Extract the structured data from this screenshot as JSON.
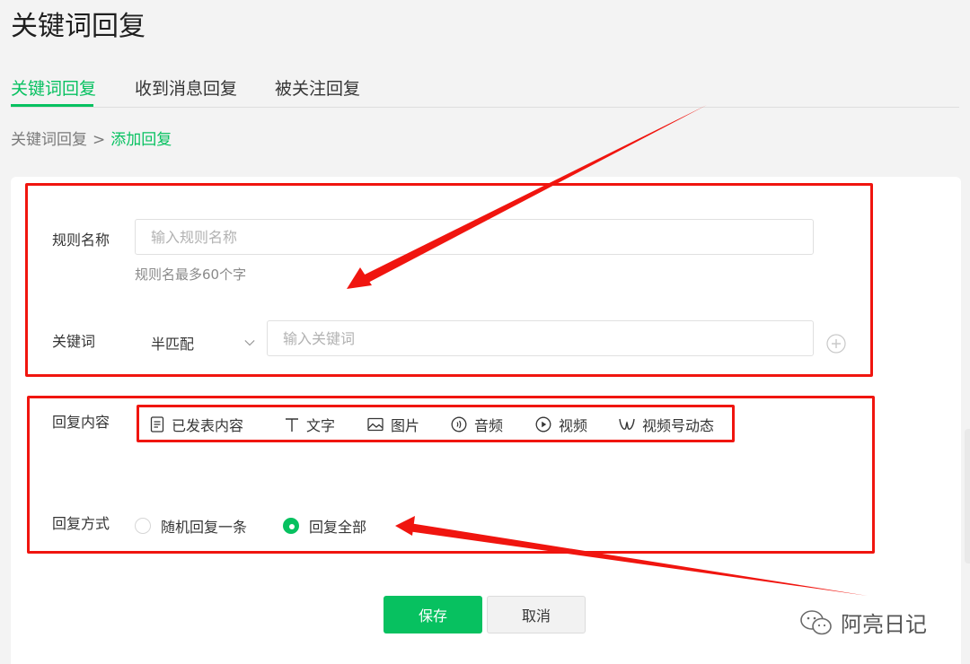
{
  "page": {
    "title": "关键词回复"
  },
  "tabs": [
    {
      "label": "关键词回复",
      "active": true
    },
    {
      "label": "收到消息回复",
      "active": false
    },
    {
      "label": "被关注回复",
      "active": false
    }
  ],
  "breadcrumb": {
    "parent": "关键词回复",
    "separator": ">",
    "current": "添加回复"
  },
  "form": {
    "rule_name": {
      "label": "规则名称",
      "placeholder": "输入规则名称",
      "value": "",
      "hint": "规则名最多60个字"
    },
    "keyword": {
      "label": "关键词",
      "match_mode": "半匹配",
      "placeholder": "输入关键词",
      "value": ""
    },
    "reply_content": {
      "label": "回复内容",
      "tools": [
        {
          "label": "已发表内容",
          "icon": "document-icon"
        },
        {
          "label": "文字",
          "icon": "text-icon"
        },
        {
          "label": "图片",
          "icon": "image-icon"
        },
        {
          "label": "音频",
          "icon": "audio-icon"
        },
        {
          "label": "视频",
          "icon": "video-icon"
        },
        {
          "label": "视频号动态",
          "icon": "channels-icon"
        }
      ]
    },
    "reply_mode": {
      "label": "回复方式",
      "options": [
        {
          "label": "随机回复一条",
          "checked": false
        },
        {
          "label": "回复全部",
          "checked": true
        }
      ]
    }
  },
  "actions": {
    "save_label": "保存",
    "cancel_label": "取消"
  },
  "watermark": {
    "text": "阿亮日记"
  },
  "colors": {
    "accent": "#07c160",
    "annotation_red": "#f0150f"
  }
}
